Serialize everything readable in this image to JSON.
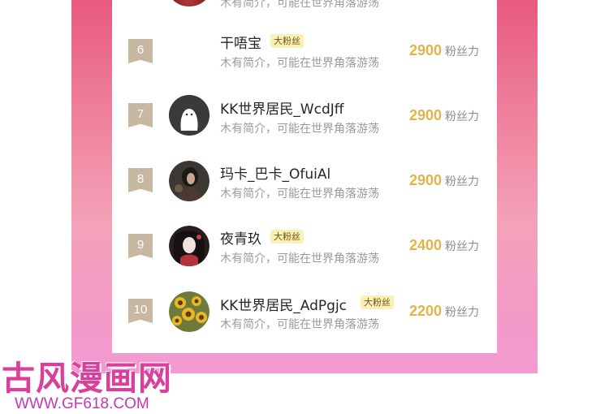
{
  "colors": {
    "frame_top": "#e85a80",
    "frame_bottom": "#f39ad1",
    "rank_badge": "#c8b7a1",
    "score": "#e0b44a",
    "fan_badge_bg": "#fbf0b8",
    "watermark": "#d93f9b"
  },
  "top_cutoff": {
    "bio": "木有简介，可能在世界角落游荡"
  },
  "rows": [
    {
      "rank": "6",
      "name": "干唔宝",
      "badge": "大粉丝",
      "bio": "木有简介，可能在世界角落游荡",
      "score": "2900",
      "unit": "粉丝力",
      "avatar": "none"
    },
    {
      "rank": "7",
      "name": "KK世界居民_WcdJff",
      "badge": "",
      "bio": "木有简介，可能在世界角落游荡",
      "score": "2900",
      "unit": "粉丝力",
      "avatar": "default-ghost-avatar"
    },
    {
      "rank": "8",
      "name": "玛卡_巴卡_OfuiAl",
      "badge": "",
      "bio": "木有简介，可能在世界角落游荡",
      "score": "2900",
      "unit": "粉丝力",
      "avatar": "photo-woman-avatar"
    },
    {
      "rank": "9",
      "name": "夜青玖",
      "badge": "大粉丝",
      "bio": "木有简介，可能在世界角落游荡",
      "score": "2400",
      "unit": "粉丝力",
      "avatar": "anime-girl-avatar"
    },
    {
      "rank": "10",
      "name": "KK世界居民_AdPgjc",
      "badge": "大粉丝",
      "bio": "木有简介，可能在世界角落游荡",
      "score": "2200",
      "unit": "粉丝力",
      "avatar": "sunflower-avatar"
    }
  ],
  "watermark": {
    "title": "古风漫画网",
    "url": "WWW.GF618.COM"
  }
}
